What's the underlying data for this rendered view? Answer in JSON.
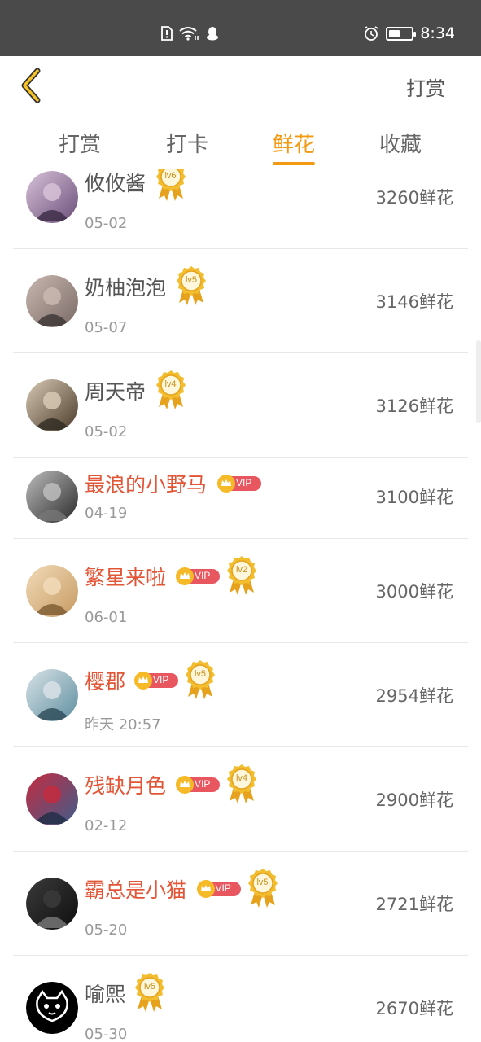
{
  "status_bar": {
    "time": "8:34",
    "battery_level": 0.5
  },
  "header": {
    "action_label": "打赏"
  },
  "tabs": [
    {
      "label": "打赏",
      "active": false
    },
    {
      "label": "打卡",
      "active": false
    },
    {
      "label": "鲜花",
      "active": true
    },
    {
      "label": "收藏",
      "active": false
    }
  ],
  "colors": {
    "accent": "#f39a12",
    "vip_name": "#e25536",
    "vip_badge": "#e8565f",
    "crown": "#f6b928"
  },
  "list": [
    {
      "name": "攸攸酱",
      "date": "05-02",
      "amount": "3260鲜花",
      "vip": false,
      "level": "lv6",
      "vip_label": ""
    },
    {
      "name": "奶柚泡泡",
      "date": "05-07",
      "amount": "3146鲜花",
      "vip": false,
      "level": "lv5",
      "vip_label": ""
    },
    {
      "name": "周天帝",
      "date": "05-02",
      "amount": "3126鲜花",
      "vip": false,
      "level": "lv4",
      "vip_label": ""
    },
    {
      "name": "最浪的小野马",
      "date": "04-19",
      "amount": "3100鲜花",
      "vip": true,
      "level": "",
      "vip_label": "VIP"
    },
    {
      "name": "繁星来啦",
      "date": "06-01",
      "amount": "3000鲜花",
      "vip": true,
      "level": "lv2",
      "vip_label": "VIP"
    },
    {
      "name": "樱郡",
      "date": "昨天 20:57",
      "amount": "2954鲜花",
      "vip": true,
      "level": "lv5",
      "vip_label": "VIP"
    },
    {
      "name": "残缺月色",
      "date": "02-12",
      "amount": "2900鲜花",
      "vip": true,
      "level": "lv4",
      "vip_label": "VIP"
    },
    {
      "name": "霸总是小猫",
      "date": "05-20",
      "amount": "2721鲜花",
      "vip": true,
      "level": "lv5",
      "vip_label": "VIP"
    },
    {
      "name": "喻熙",
      "date": "05-30",
      "amount": "2670鲜花",
      "vip": false,
      "level": "lv5",
      "vip_label": ""
    }
  ]
}
